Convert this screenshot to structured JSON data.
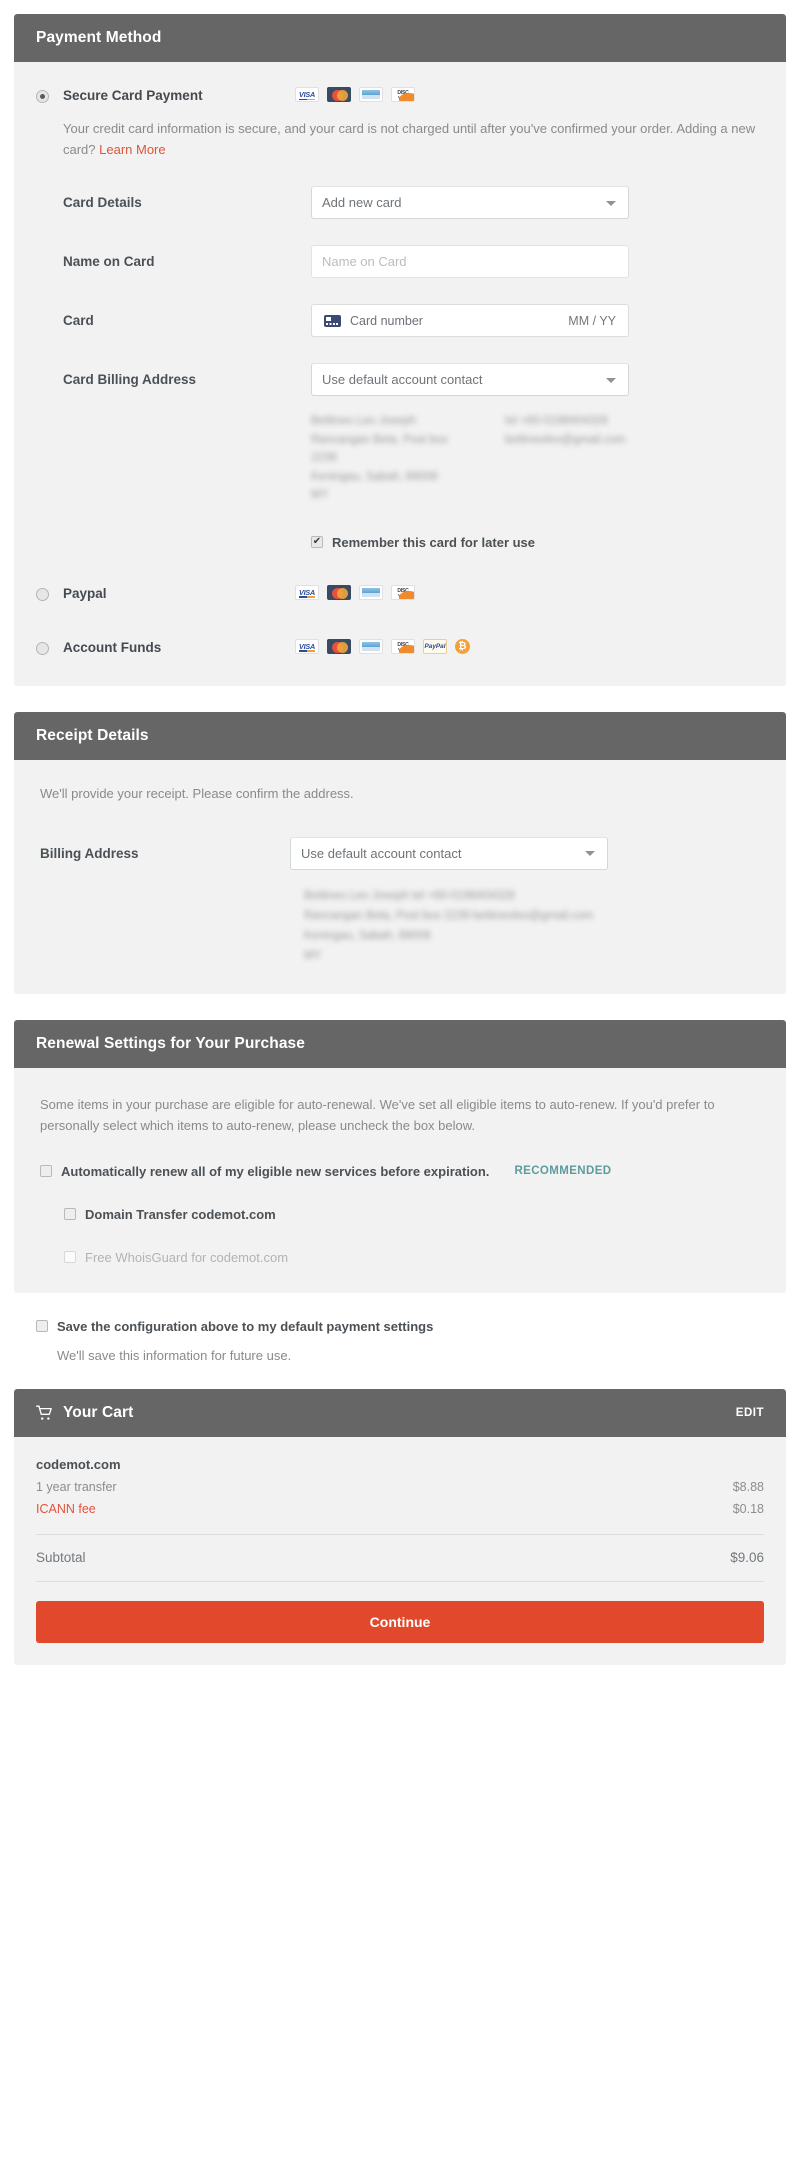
{
  "payment": {
    "title": "Payment Method",
    "options": [
      {
        "label": "Secure Card Payment",
        "selected": true,
        "marks": [
          "visa-icon",
          "mastercard-icon",
          "amex-icon",
          "discover-icon"
        ]
      },
      {
        "label": "Paypal",
        "selected": false,
        "marks": [
          "visa-icon",
          "mastercard-icon",
          "amex-icon",
          "discover-icon"
        ]
      },
      {
        "label": "Account Funds",
        "selected": false,
        "marks": [
          "visa-icon",
          "mastercard-icon",
          "amex-icon",
          "discover-icon",
          "paypal-icon",
          "bitcoin-icon"
        ]
      }
    ],
    "description_pre": "Your credit card information is secure, and your card is not charged until after you've confirmed your order. Adding a new card? ",
    "description_link": "Learn More",
    "card_details_label": "Card Details",
    "card_details_value": "Add new card",
    "name_on_card_label": "Name on Card",
    "name_on_card_placeholder": "Name on Card",
    "card_label": "Card",
    "card_number_placeholder": "Card number",
    "card_expiry_placeholder": "MM / YY",
    "card_billing_address_label": "Card Billing Address",
    "card_billing_address_value": "Use default account contact",
    "billing_address_lines_col1": [
      "Bettineo Leo Joseph",
      "Rancangan Beta, Post box",
      "2239",
      "Keningau, Sabah, 89008",
      "MY"
    ],
    "billing_address_lines_col2": [
      "tel +60-0198404328",
      "bettineoleo@gmail.com"
    ],
    "remember_card_label": "Remember this card for later use",
    "remember_card_checked": true
  },
  "receipt": {
    "title": "Receipt Details",
    "note": "We'll provide your receipt. Please confirm the address.",
    "billing_address_label": "Billing Address",
    "billing_address_value": "Use default account contact",
    "address_lines": [
      "Bettineo Leo Joseph                    tel +60-0198404328",
      "Rancangan Beta, Post box 2239  bettineoleo@gmail.com",
      "Keningau, Sabah, 89008",
      "MY"
    ]
  },
  "renewal": {
    "title": "Renewal Settings for Your Purchase",
    "note": "Some items in your purchase are eligible for auto-renewal. We've set all eligible items to auto-renew. If you'd prefer to personally select which items to auto-renew, please uncheck the box below.",
    "auto_renew_label": "Automatically renew all of my eligible new services before expiration.",
    "recommended_badge": "RECOMMENDED",
    "items": [
      {
        "label": "Domain Transfer codemot.com",
        "disabled": false
      },
      {
        "label": "Free WhoisGuard for codemot.com",
        "disabled": true
      }
    ]
  },
  "save_settings": {
    "label": "Save the configuration above to my default payment settings",
    "note": "We'll save this information for future use."
  },
  "cart": {
    "title": "Your Cart",
    "edit_label": "EDIT",
    "item_name": "codemot.com",
    "lines": [
      {
        "label": "1 year transfer",
        "amount": "$8.88",
        "fee": false
      },
      {
        "label": "ICANN fee",
        "amount": "$0.18",
        "fee": true
      }
    ],
    "subtotal_label": "Subtotal",
    "subtotal_amount": "$9.06",
    "continue_label": "Continue"
  },
  "colors": {
    "header_bg": "#666666",
    "panel_bg": "#f2f2f2",
    "accent_red": "#e2492c",
    "link_red": "#e2533a",
    "recommended_teal": "#5c9c9c"
  }
}
